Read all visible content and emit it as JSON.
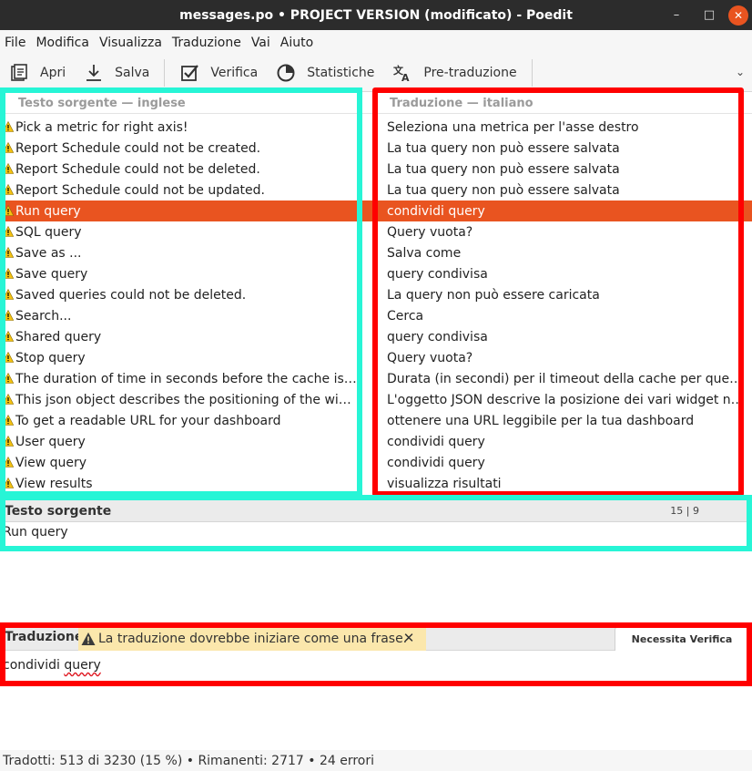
{
  "window": {
    "title": "messages.po • PROJECT VERSION (modificato) - Poedit",
    "minimize": "–",
    "maximize": "□",
    "close": "✕"
  },
  "menu": [
    "File",
    "Modifica",
    "Visualizza",
    "Traduzione",
    "Vai",
    "Aiuto"
  ],
  "toolbar": {
    "open_label": "Apri",
    "save_label": "Salva",
    "verify_label": "Verifica",
    "stats_label": "Statistiche",
    "pretranslate_label": "Pre-traduzione",
    "more": "⌄"
  },
  "list": {
    "source_header": "Testo sorgente — inglese",
    "translation_header": "Traduzione — italiano",
    "selected_index": 4,
    "rows": [
      {
        "source": "Pick a metric for right axis!",
        "translation": "Seleziona una metrica per l'asse destro"
      },
      {
        "source": "Report Schedule could not be created.",
        "translation": "La tua query non può essere salvata"
      },
      {
        "source": "Report Schedule could not be deleted.",
        "translation": "La tua query non può essere salvata"
      },
      {
        "source": "Report Schedule could not be updated.",
        "translation": "La tua query non può essere salvata"
      },
      {
        "source": "Run query",
        "translation": "condividi query"
      },
      {
        "source": "SQL query",
        "translation": "Query vuota?"
      },
      {
        "source": "Save as ...",
        "translation": "Salva come"
      },
      {
        "source": "Save query",
        "translation": "query condivisa"
      },
      {
        "source": "Saved queries could not be deleted.",
        "translation": "La query non può essere caricata"
      },
      {
        "source": "Search...",
        "translation": "Cerca"
      },
      {
        "source": "Shared query",
        "translation": "query condivisa"
      },
      {
        "source": "Stop query",
        "translation": "Query vuota?"
      },
      {
        "source": "The duration of time in seconds before the cache is invalidated",
        "translation": "Durata (in secondi) per il timeout della cache per questa slice."
      },
      {
        "source": "This json object describes the positioning of the widgets in the dashboard",
        "translation": "L'oggetto JSON descrive la posizione dei vari widget nella dashboard"
      },
      {
        "source": "To get a readable URL for your dashboard",
        "translation": "ottenere una URL leggibile per la tua dashboard"
      },
      {
        "source": "User query",
        "translation": "condividi query"
      },
      {
        "source": "View query",
        "translation": "condividi query"
      },
      {
        "source": "View results",
        "translation": "visualizza risultati"
      }
    ]
  },
  "source_panel": {
    "title": "Testo sorgente",
    "counter": "15 | 9",
    "text": "Run query"
  },
  "translation_panel": {
    "title": "Traduzione",
    "warning": "La traduzione dovrebbe iniziare come una frase.",
    "warning_close": "✕",
    "needs_review": "Necessita Verifica",
    "text_word1": "condividi",
    "text_word2": "query"
  },
  "status": {
    "text": "Tradotti: 513 di 3230 (15 %)  •  Rimanenti: 2717  •  24 errori"
  },
  "colors": {
    "selection": "#e95420",
    "highlight_cyan": "#27f5d6",
    "highlight_red": "#ff0000",
    "warning_banner": "#fbe7ac"
  }
}
